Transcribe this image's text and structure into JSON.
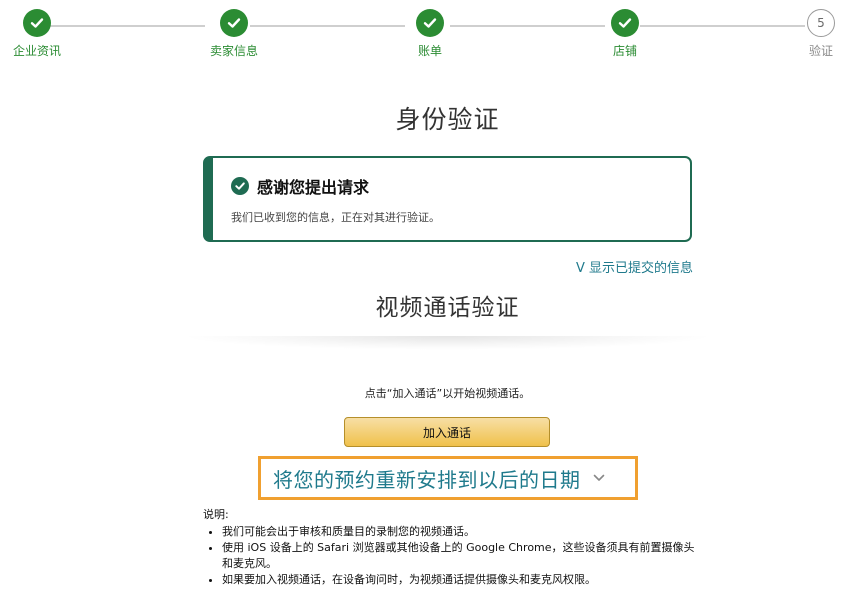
{
  "stepper": {
    "steps": [
      {
        "label": "企业资讯",
        "status": "done"
      },
      {
        "label": "卖家信息",
        "status": "done"
      },
      {
        "label": "账单",
        "status": "done"
      },
      {
        "label": "店铺",
        "status": "done"
      },
      {
        "label": "验证",
        "status": "current",
        "number": "5"
      }
    ],
    "colors": {
      "done": "#2b8c33",
      "pending": "#8a8a8a"
    }
  },
  "page": {
    "title": "身份验证"
  },
  "alert": {
    "title": "感谢您提出请求",
    "message": "我们已收到您的信息，正在对其进行验证。",
    "icon": "check-circle-icon",
    "color": "#1f6b52"
  },
  "links": {
    "show_submitted": "V 显示已提交的信息"
  },
  "video": {
    "title": "视频通话验证",
    "instruction": "点击“加入通话”以开始视频通话。",
    "join_button": "加入通话",
    "reschedule": "将您的预约重新安排到以后的日期",
    "reschedule_icon": "chevron-down-icon",
    "highlight_color": "#f0a030",
    "button_color": "#f0c14b"
  },
  "notes": {
    "title": "说明:",
    "items": [
      "我们可能会出于审核和质量目的录制您的视频通话。",
      "使用 iOS 设备上的 Safari 浏览器或其他设备上的 Google Chrome，这些设备须具有前置摄像头和麦克风。",
      "如果要加入视频通话，在设备询问时，为视频通话提供摄像头和麦克风权限。"
    ]
  }
}
